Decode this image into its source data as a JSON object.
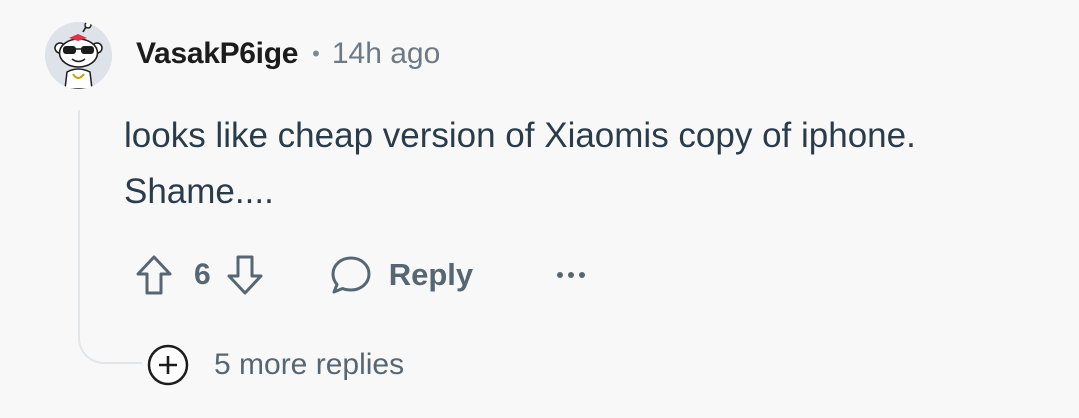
{
  "comment": {
    "username": "VasakP6ige",
    "separator": "•",
    "timestamp": "14h ago",
    "body": "looks like cheap version of Xiaomis copy of iphone. Shame....",
    "avatar_icon": "snoo-sunglasses-avatar",
    "votes": {
      "count": "6",
      "upvote_icon": "arrow-up-icon",
      "downvote_icon": "arrow-down-icon"
    },
    "reply": {
      "label": "Reply",
      "icon": "speech-bubble-icon"
    },
    "more_icon": "ellipsis-icon"
  },
  "more_replies": {
    "label": "5 more replies",
    "icon": "plus-circle-icon"
  },
  "colors": {
    "background": "#f8f8f8",
    "username": "#1c1c1c",
    "meta": "#6b7a85",
    "body": "#2a3c4a",
    "action": "#566773",
    "thread_line": "#e2e6e9"
  }
}
